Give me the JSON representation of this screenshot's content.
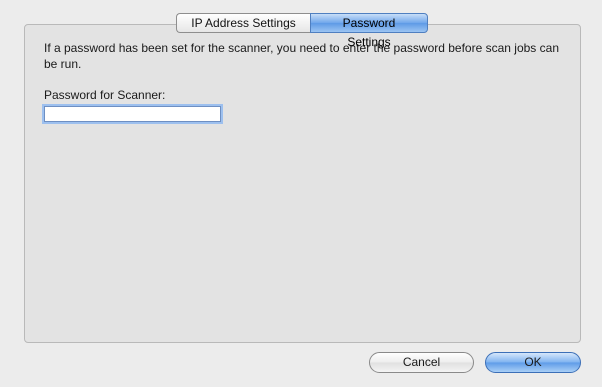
{
  "tabs": [
    {
      "label": "IP Address Settings",
      "selected": false
    },
    {
      "label": "Password Settings",
      "selected": true
    }
  ],
  "content": {
    "description": "If a password has been set for the scanner, you need to enter the password before scan jobs can be run.",
    "password_label": "Password for Scanner:",
    "password_value": ""
  },
  "buttons": {
    "cancel_label": "Cancel",
    "ok_label": "OK"
  },
  "colors": {
    "accent": "#6fa6eb",
    "panel_background": "#e3e3e3",
    "window_background": "#ececec"
  }
}
